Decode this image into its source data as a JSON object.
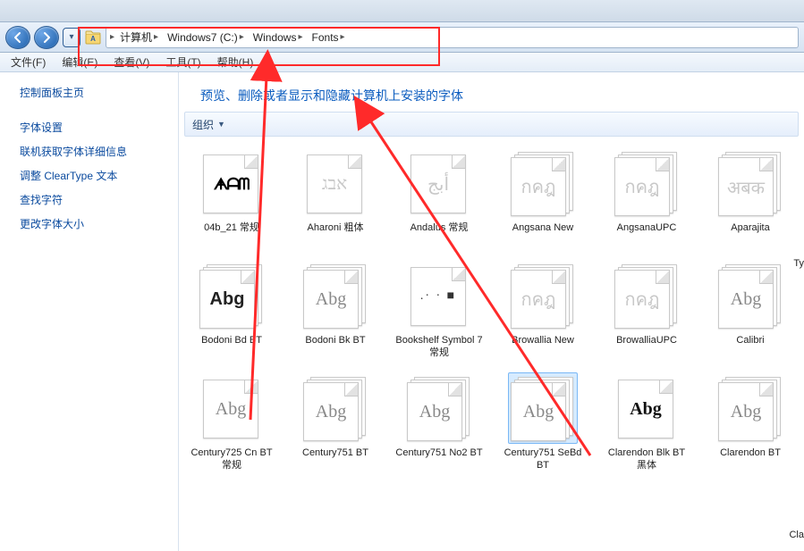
{
  "breadcrumb": {
    "parts": [
      "计算机",
      "Windows7 (C:)",
      "Windows",
      "Fonts"
    ]
  },
  "menubar": {
    "items": [
      "文件(F)",
      "编辑(E)",
      "查看(V)",
      "工具(T)",
      "帮助(H)"
    ]
  },
  "sidebar": {
    "title": "控制面板主页",
    "links": [
      "字体设置",
      "联机获取字体详细信息",
      "调整 ClearType 文本",
      "查找字符",
      "更改字体大小"
    ]
  },
  "content": {
    "header": "预览、删除或者显示和隐藏计算机上安装的字体",
    "toolbar_org": "组织",
    "truncated": {
      "row1": "Ty",
      "row3": "Cla"
    }
  },
  "fonts": {
    "row1": [
      {
        "label": "04b_21 常规",
        "preview": "ᗗᗩᗰ",
        "cls": "pix",
        "single": true
      },
      {
        "label": "Aharoni 粗体",
        "preview": "אבג",
        "cls": "faint",
        "single": true
      },
      {
        "label": "Andalus 常规",
        "preview": "أبج",
        "cls": "faint",
        "single": true
      },
      {
        "label": "Angsana New",
        "preview": "กคฎ",
        "cls": "faint"
      },
      {
        "label": "AngsanaUPC",
        "preview": "กคฎ",
        "cls": "faint"
      },
      {
        "label": "Aparajita",
        "preview": "अबक",
        "cls": "faint"
      },
      {
        "label": "",
        "preview": "",
        "cls": ""
      }
    ],
    "row2": [
      {
        "label": "Bodoni Bd BT",
        "preview": "Abg",
        "cls": "strong"
      },
      {
        "label": "Bodoni Bk BT",
        "preview": "Abg",
        "cls": ""
      },
      {
        "label": "Bookshelf Symbol 7 常规",
        "preview": ".· · ■",
        "cls": "sym",
        "single": true
      },
      {
        "label": "Browallia New",
        "preview": "กคฎ",
        "cls": "faint"
      },
      {
        "label": "BrowalliaUPC",
        "preview": "กคฎ",
        "cls": "faint"
      },
      {
        "label": "Calibri",
        "preview": "Abg",
        "cls": ""
      },
      {
        "label": "",
        "preview": "",
        "cls": ""
      }
    ],
    "row3": [
      {
        "label": "Century725 Cn BT 常规",
        "preview": "Abg",
        "cls": "",
        "single": true
      },
      {
        "label": "Century751 BT",
        "preview": "Abg",
        "cls": ""
      },
      {
        "label": "Century751 No2 BT",
        "preview": "Abg",
        "cls": ""
      },
      {
        "label": "Century751 SeBd BT",
        "preview": "Abg",
        "cls": "",
        "selected": true
      },
      {
        "label": "Clarendon Blk BT 黑体",
        "preview": "Abg",
        "cls": "clar",
        "single": true
      },
      {
        "label": "Clarendon BT",
        "preview": "Abg",
        "cls": ""
      },
      {
        "label": "",
        "preview": "",
        "cls": ""
      }
    ]
  }
}
